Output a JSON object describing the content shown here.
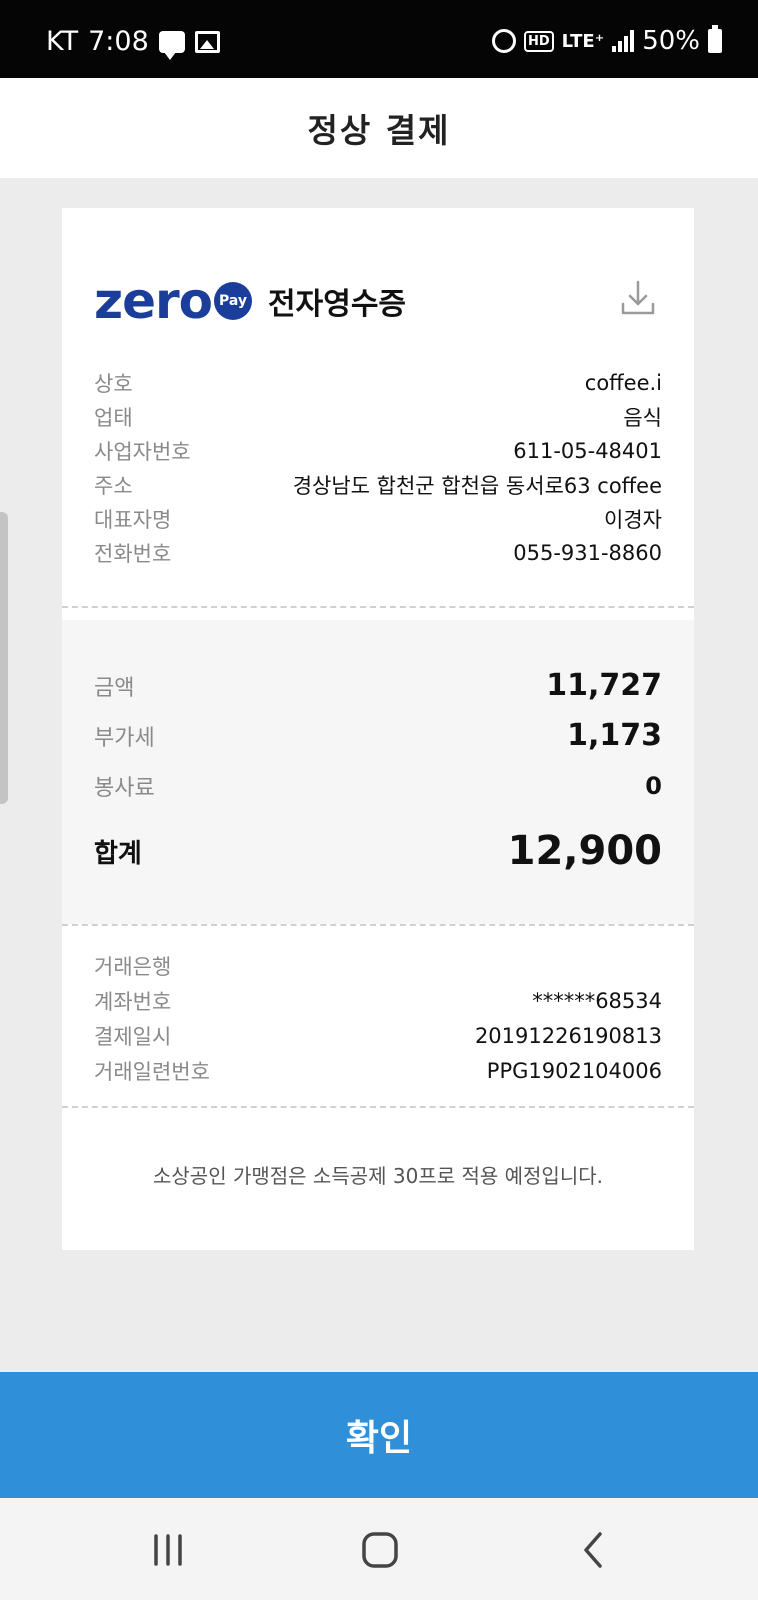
{
  "status_bar": {
    "carrier": "KT",
    "time": "7:08",
    "hd": "HD",
    "network": "LTE⁺",
    "battery": "50%"
  },
  "header": {
    "title": "정상 결제"
  },
  "receipt": {
    "logo_text": "zero",
    "logo_badge": "Pay",
    "title": "전자영수증",
    "merchant": [
      {
        "label": "상호",
        "value": "coffee.i"
      },
      {
        "label": "업태",
        "value": "음식"
      },
      {
        "label": "사업자번호",
        "value": "611-05-48401"
      },
      {
        "label": "주소",
        "value": "경상남도 합천군 합천읍 동서로63 coffee"
      },
      {
        "label": "대표자명",
        "value": "이경자"
      },
      {
        "label": "전화번호",
        "value": "055-931-8860"
      }
    ],
    "amounts": {
      "amount": {
        "label": "금액",
        "value": "11,727"
      },
      "vat": {
        "label": "부가세",
        "value": "1,173"
      },
      "service": {
        "label": "봉사료",
        "value": "0"
      },
      "total": {
        "label": "합계",
        "value": "12,900"
      }
    },
    "transaction": [
      {
        "label": "거래은행",
        "value": ""
      },
      {
        "label": "계좌번호",
        "value": "******68534"
      },
      {
        "label": "결제일시",
        "value": "20191226190813"
      },
      {
        "label": "거래일련번호",
        "value": "PPG1902104006"
      }
    ],
    "notice": "소상공인 가맹점은 소득공제 30프로 적용 예정입니다."
  },
  "confirm_label": "확인",
  "colors": {
    "brand": "#1c3e9b",
    "confirm": "#2f8fd8",
    "background": "#ececec"
  }
}
